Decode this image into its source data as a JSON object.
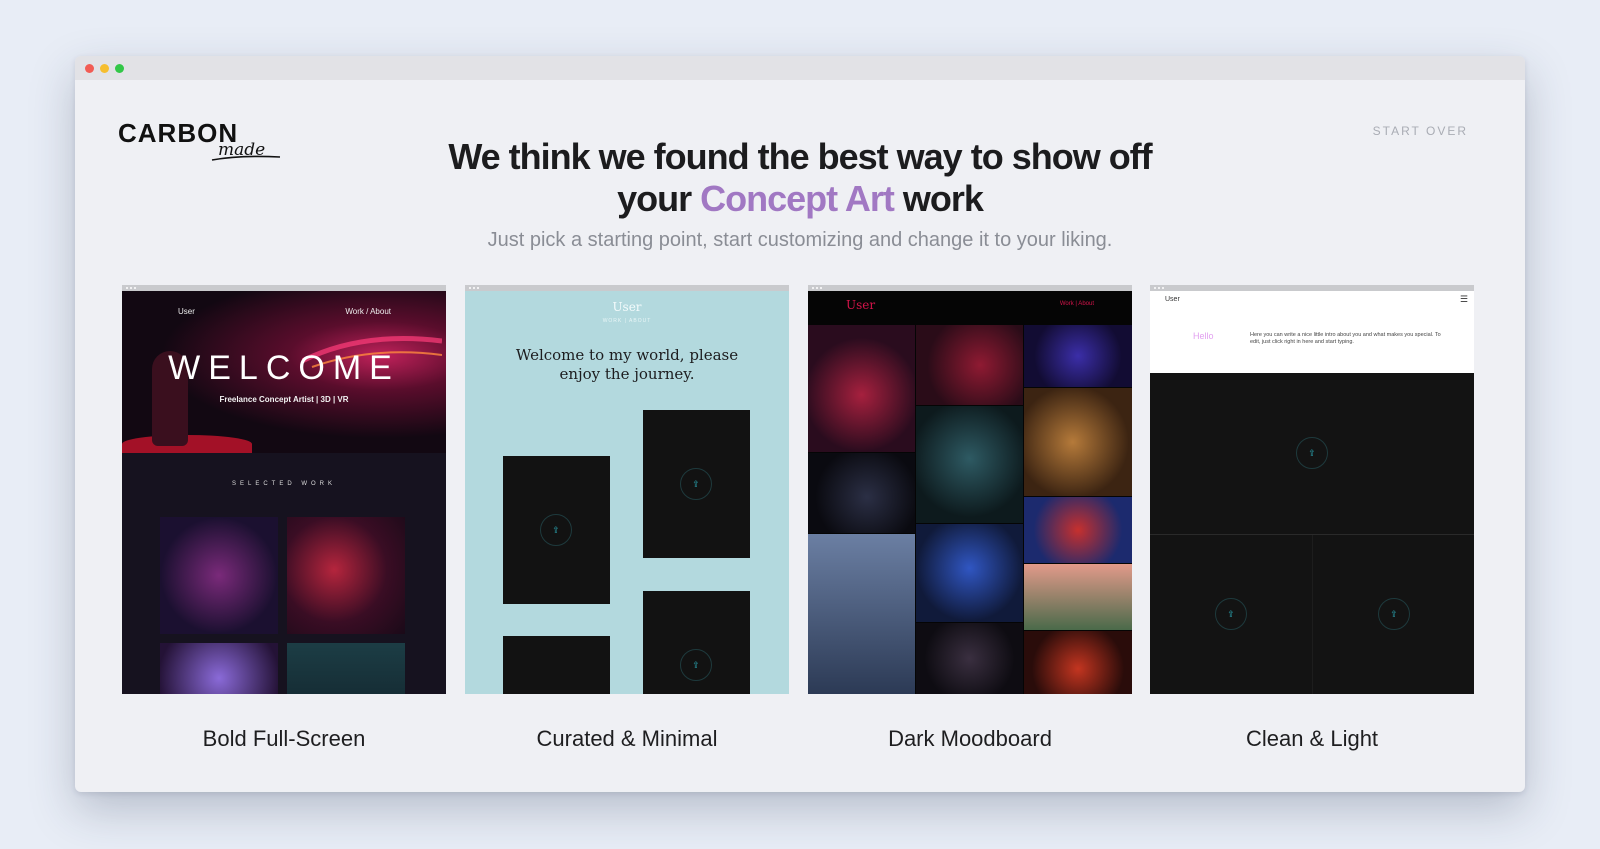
{
  "window": {
    "controls": [
      "close",
      "minimize",
      "maximize"
    ]
  },
  "header": {
    "logo_main": "CARBON",
    "logo_sub": "made",
    "start_over": "START OVER"
  },
  "headline": {
    "line1": "We think we found the best way to show off",
    "line2_prefix": "your ",
    "line2_accent": "Concept Art",
    "line2_suffix": " work",
    "subtitle": "Just pick a starting point, start customizing and change it to your liking.",
    "accent_color": "#a178c3"
  },
  "templates": [
    {
      "label": "Bold Full-Screen",
      "preview": {
        "nav_user": "User",
        "nav_right": "Work / About",
        "hero_title": "WELCOME",
        "hero_tagline": "Freelance Concept Artist | 3D | VR",
        "section": "SELECTED WORK"
      }
    },
    {
      "label": "Curated & Minimal",
      "preview": {
        "nav_user": "User",
        "nav_sub": "WORK | ABOUT",
        "message": "Welcome to my world, please enjoy the journey."
      }
    },
    {
      "label": "Dark Moodboard",
      "preview": {
        "nav_user": "User",
        "nav_right": "Work | About"
      }
    },
    {
      "label": "Clean & Light",
      "preview": {
        "nav_user": "User",
        "menu_icon": "☰",
        "hello": "Hello",
        "intro": "Here you can write a nice little intro about you and what makes you special. To edit, just click right in here and start typing."
      }
    }
  ]
}
